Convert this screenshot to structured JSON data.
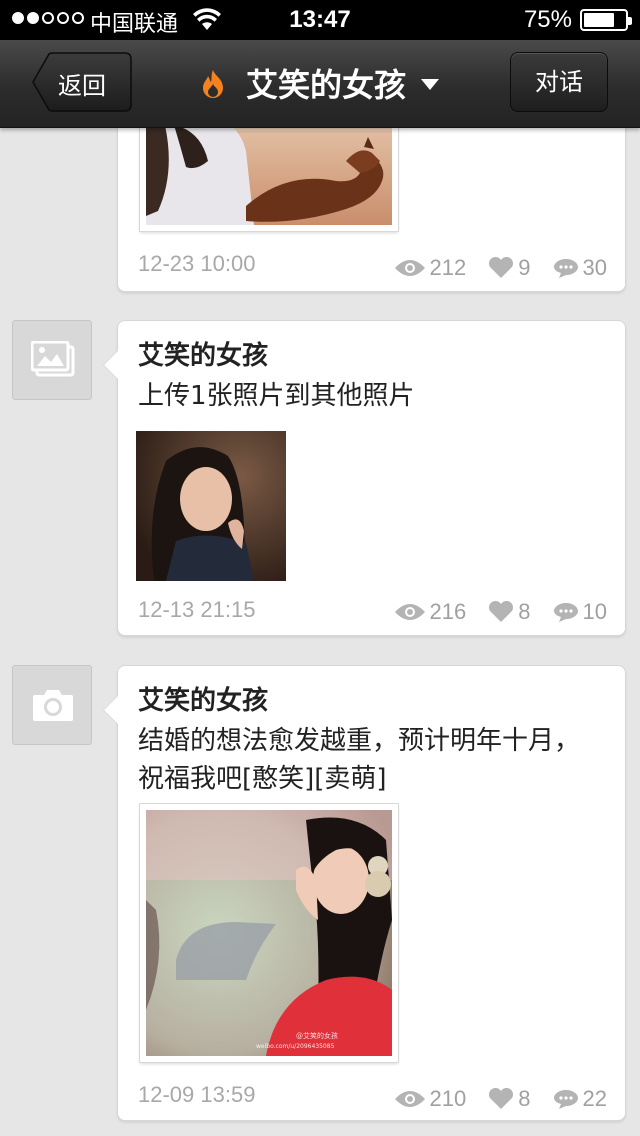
{
  "status_bar": {
    "carrier": "中国联通",
    "time": "13:47",
    "battery": "75%",
    "battery_level": 0.75
  },
  "nav": {
    "back_label": "返回",
    "title": "艾笑的女孩",
    "talk_label": "对话"
  },
  "feed": [
    {
      "timestamp": "12-23 10:00",
      "views": "212",
      "likes": "9",
      "comments": "30"
    },
    {
      "type_icon": "photo-album-icon",
      "author": "艾笑的女孩",
      "text": "上传1张照片到其他照片",
      "timestamp": "12-13 21:15",
      "views": "216",
      "likes": "8",
      "comments": "10"
    },
    {
      "type_icon": "camera-icon",
      "author": "艾笑的女孩",
      "text": "结婚的想法愈发越重，预计明年十月，祝福我吧[憨笑][卖萌]",
      "timestamp": "12-09 13:59",
      "views": "210",
      "likes": "8",
      "comments": "22"
    }
  ],
  "colors": {
    "nav_bg": "#2c2c2c",
    "page_bg": "#e6e6e6",
    "flame": "#f5821f",
    "meta_text": "#a8a8a8"
  }
}
